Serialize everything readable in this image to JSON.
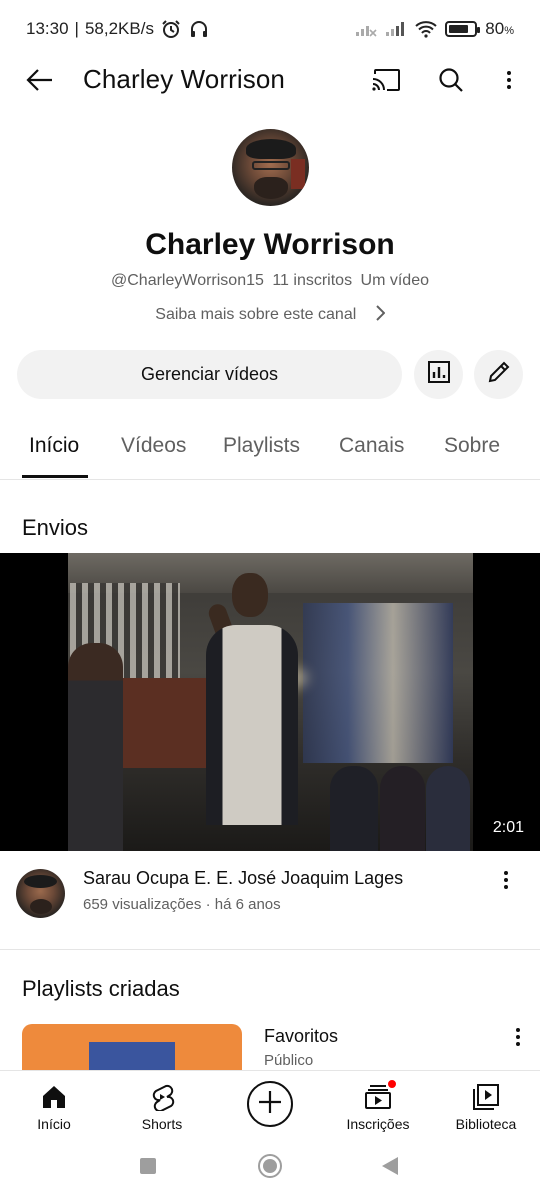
{
  "status_bar": {
    "time": "13:30",
    "net_speed": "58,2KB/s",
    "battery": "80",
    "battery_level": 0.8,
    "icons": [
      "alarm-icon",
      "headphones-icon",
      "signal-x-icon",
      "signal-icon",
      "wifi-icon",
      "battery-icon"
    ]
  },
  "app_bar": {
    "title": "Charley Worrison",
    "icons": [
      "back-arrow-icon",
      "cast-icon",
      "search-icon",
      "more-vert-icon"
    ]
  },
  "channel": {
    "name": "Charley Worrison",
    "handle": "@CharleyWorrison15",
    "subscribers": "11 inscritos",
    "videos": "Um vídeo",
    "more_link": "Saiba mais sobre este canal",
    "manage_label": "Gerenciar vídeos",
    "buttons": [
      "analytics-icon",
      "edit-pencil-icon"
    ]
  },
  "tabs": [
    {
      "label": "Início",
      "active": true
    },
    {
      "label": "Vídeos",
      "active": false
    },
    {
      "label": "Playlists",
      "active": false
    },
    {
      "label": "Canais",
      "active": false
    },
    {
      "label": "Sobre",
      "active": false
    }
  ],
  "uploads": {
    "section_title": "Envios",
    "video": {
      "title": "Sarau Ocupa E. E. José Joaquim Lages",
      "meta": "659 visualizações · há 6 anos",
      "duration": "2:01"
    }
  },
  "playlists": {
    "section_title": "Playlists criadas",
    "items": [
      {
        "title": "Favoritos",
        "visibility": "Público"
      }
    ]
  },
  "bottom_nav": [
    {
      "label": "Início",
      "icon": "home-icon"
    },
    {
      "label": "Shorts",
      "icon": "shorts-icon"
    },
    {
      "label": "",
      "icon": "create-plus-icon"
    },
    {
      "label": "Inscrições",
      "icon": "subscriptions-icon"
    },
    {
      "label": "Biblioteca",
      "icon": "library-icon"
    }
  ],
  "system_nav": [
    "recents-square-icon",
    "home-circle-icon",
    "back-triangle-icon"
  ],
  "colors": {
    "text_primary": "#0f0f0f",
    "text_secondary": "#606060",
    "chip_bg": "#f2f2f2",
    "notification_dot": "#ff0000",
    "playlist_thumb": "#ee8a3c"
  }
}
